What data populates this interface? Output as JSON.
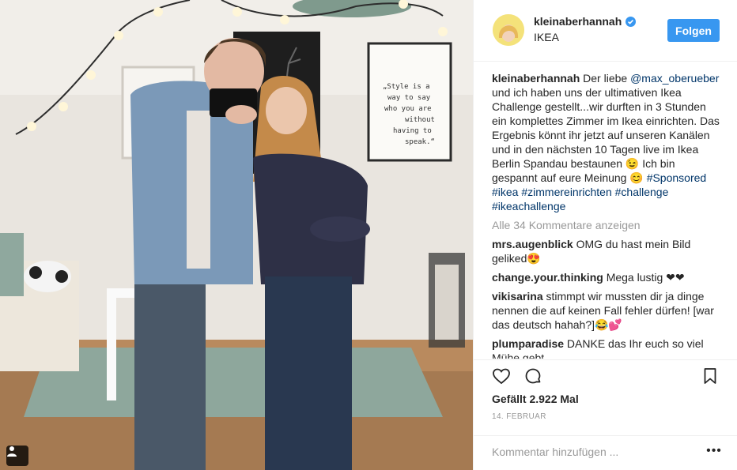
{
  "post": {
    "username": "kleinaberhannah",
    "verified": true,
    "location": "IKEA",
    "follow_label": "Folgen",
    "accent_color": "#3897f0",
    "caption": {
      "username": "kleinaberhannah",
      "t1": "Der liebe",
      "mention": "@max_oberueber",
      "t2": "und ich haben uns der ultimativen Ikea Challenge gestellt...wir durften in 3 Stunden ein komplettes Zimmer im Ikea einrichten. Das Ergebnis könnt ihr jetzt auf unseren Kanälen und in den nächsten 10 Tagen live im Ikea Berlin Spandau bestaunen 😉 Ich bin gespannt auf eure Meinung 😊",
      "hashtags": [
        "#Sponsored",
        "#ikea",
        "#zimmereinrichten",
        "#challenge",
        "#ikeachallenge"
      ]
    },
    "view_all_comments": "Alle 34 Kommentare anzeigen",
    "comments": [
      {
        "username": "mrs.augenblick",
        "text": "OMG du hast mein Bild geliked😍"
      },
      {
        "username": "change.your.thinking",
        "text": "Mega lustig ❤❤"
      },
      {
        "username": "vikisarina",
        "text": "stimmpt wir mussten dir ja dinge nennen die auf keinen Fall fehler dürfen! [war das deutsch hahah?]😂💕"
      },
      {
        "username": "plumparadise",
        "text": "DANKE das Ihr euch so viel Mühe gebt"
      }
    ],
    "likes": "Gefällt 2.922 Mal",
    "date": "14. FEBRUAR",
    "add_comment_placeholder": "Kommentar hinzufügen ...",
    "more_label": "•••",
    "icons": {
      "like": "heart-icon",
      "comment": "comment-icon",
      "save": "bookmark-icon",
      "tag": "user-tag-icon",
      "verified": "verified-badge-icon"
    },
    "poster_text": "„Style is a way to say who you are without having to speak.“"
  }
}
